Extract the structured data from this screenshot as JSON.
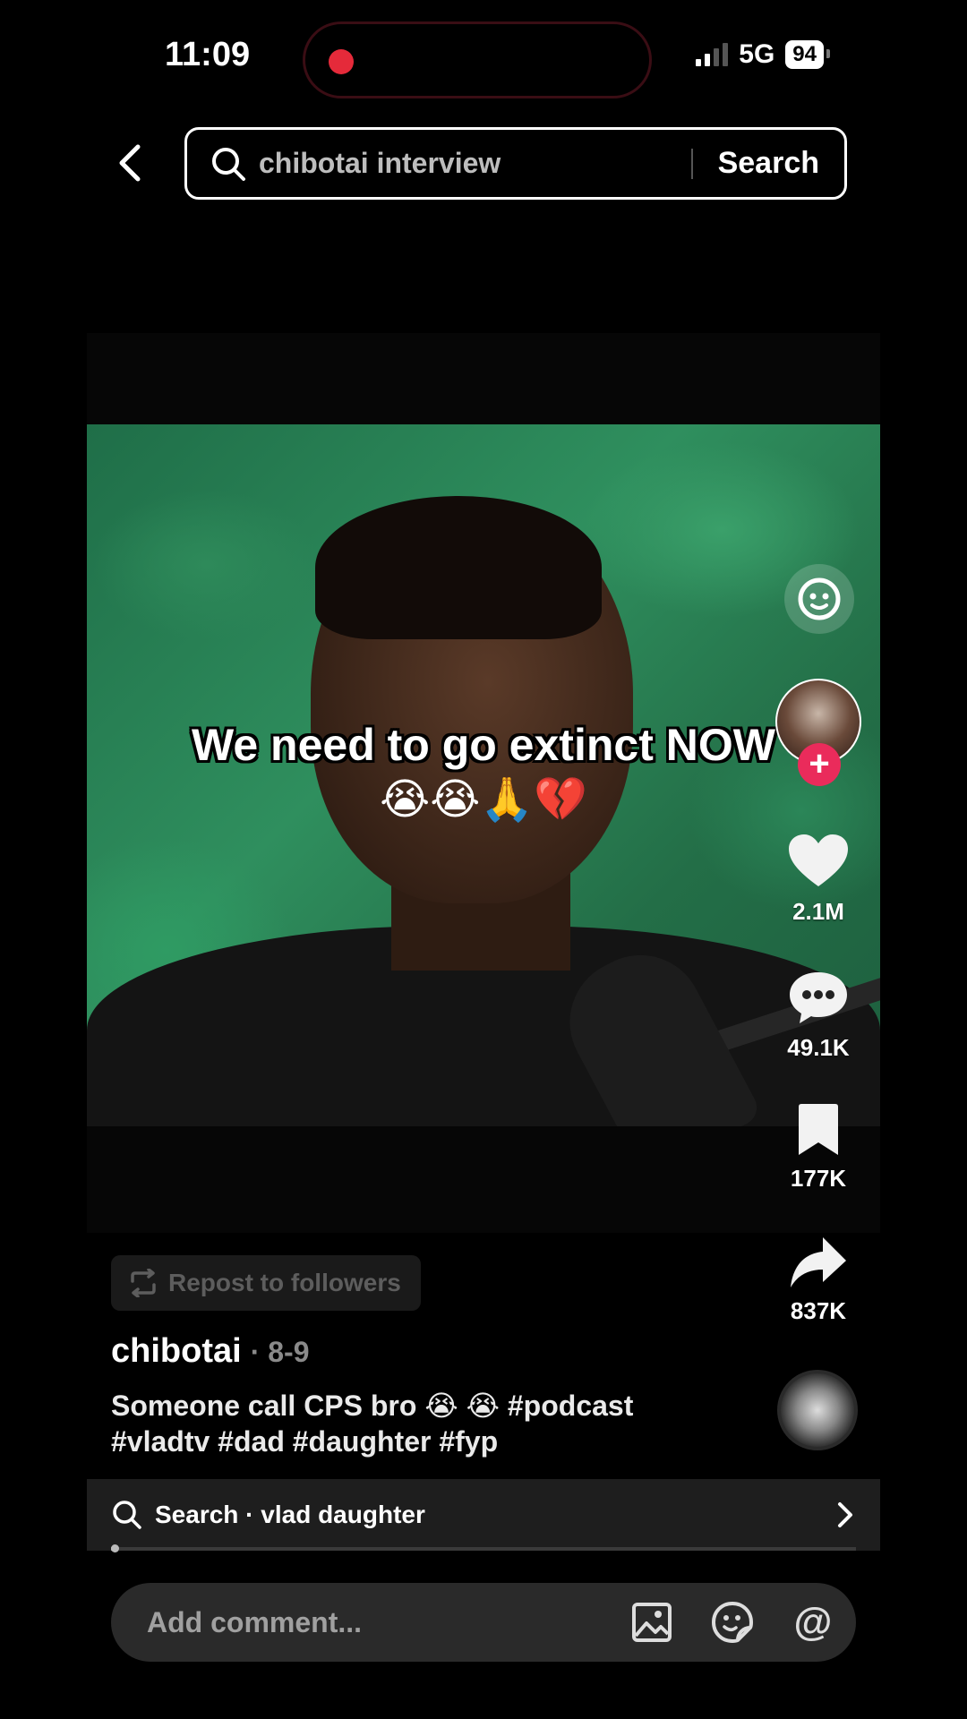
{
  "status_bar": {
    "time": "11:09",
    "network": "5G",
    "battery": "94",
    "recording_color": "#e52a3a"
  },
  "search": {
    "query": "chibotai interview",
    "button_label": "Search"
  },
  "video": {
    "overlay_text": "We need to go extinct NOW",
    "overlay_emoji": "😭😭🙏💔"
  },
  "actions": {
    "likes": "2.1M",
    "comments": "49.1K",
    "saves": "177K",
    "shares": "837K",
    "icons": [
      "ai-chat-icon",
      "heart-icon",
      "comment-icon",
      "bookmark-icon",
      "share-icon"
    ]
  },
  "post": {
    "repost_label": "Repost to followers",
    "author": "chibotai",
    "date": "· 8-9",
    "caption": "Someone call CPS bro 😭 😭 #podcast #vladtv #dad #daughter #fyp"
  },
  "related_search": {
    "label": "Search · vlad daughter"
  },
  "progress": 0.01,
  "comment": {
    "placeholder": "Add comment..."
  },
  "colors": {
    "accent": "#ea2b5b",
    "background": "#000000"
  }
}
